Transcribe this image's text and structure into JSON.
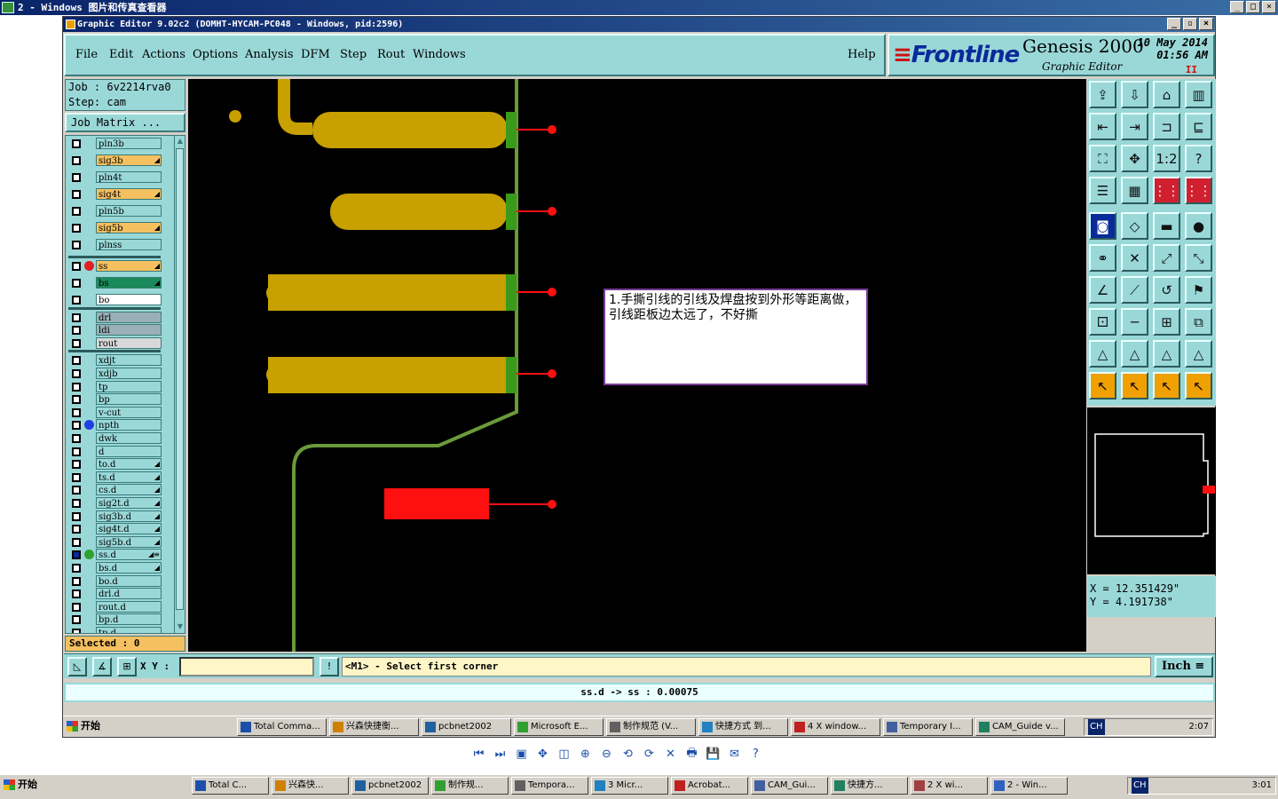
{
  "viewer": {
    "title": "2 - Windows 图片和传真查看器",
    "tools": [
      "⏮",
      "⏭",
      "▣",
      "✥",
      "◫",
      "⊕",
      "⊖",
      "⟲",
      "⟳",
      "✕",
      "🖶",
      "💾",
      "✉",
      "?"
    ]
  },
  "app": {
    "title": "Graphic Editor 9.02c2  (DOMHT-HYCAM-PC048 - Windows, pid:2596)",
    "menu": [
      "File",
      "Edit",
      "Actions",
      "Options",
      "Analysis",
      "DFM",
      "Step",
      "Rout",
      "Windows"
    ],
    "help": "Help",
    "logo": {
      "brand": "Frontline",
      "product": "Genesis 2000",
      "sub": "Graphic Editor",
      "date_line1": "10 May 2014",
      "date_line2": "01:56 AM",
      "pause": "II"
    }
  },
  "job": {
    "line1": "Job :  6v2214rva0",
    "line2": "Step: cam",
    "matrix_btn": "Job Matrix ..."
  },
  "layers": [
    {
      "name": "pln3b",
      "color": "#9ad8d8",
      "flag": ""
    },
    {
      "name": "sig3b",
      "color": "#f5c060",
      "flag": "◢"
    },
    {
      "name": "pln4t",
      "color": "#9ad8d8",
      "flag": ""
    },
    {
      "name": "sig4t",
      "color": "#f5c060",
      "flag": "◢"
    },
    {
      "name": "pln5b",
      "color": "#9ad8d8",
      "flag": ""
    },
    {
      "name": "sig5b",
      "color": "#f5c060",
      "flag": "◢"
    },
    {
      "name": "plnss",
      "color": "#9ad8d8",
      "flag": ""
    },
    {
      "name": "ss",
      "color": "#f5c060",
      "flag": "◢",
      "dot": "#e02020"
    },
    {
      "name": "bs",
      "color": "#1a8a5a",
      "flag": "◢"
    },
    {
      "name": "bo",
      "color": "#ffffff",
      "flag": ""
    },
    {
      "name": "drl",
      "color": "#9ab0b8",
      "flag": ""
    },
    {
      "name": "ldi",
      "color": "#9ab0b8",
      "flag": ""
    },
    {
      "name": "rout",
      "color": "#d8d8d8",
      "flag": ""
    },
    {
      "name": "xdjt",
      "color": "#9ad8d8",
      "flag": ""
    },
    {
      "name": "xdjb",
      "color": "#9ad8d8",
      "flag": ""
    },
    {
      "name": "tp",
      "color": "#9ad8d8",
      "flag": ""
    },
    {
      "name": "bp",
      "color": "#9ad8d8",
      "flag": ""
    },
    {
      "name": "v-cut",
      "color": "#9ad8d8",
      "flag": ""
    },
    {
      "name": "npth",
      "color": "#9ad8d8",
      "flag": "",
      "dot": "#2040e0"
    },
    {
      "name": "dwk",
      "color": "#9ad8d8",
      "flag": ""
    },
    {
      "name": "d",
      "color": "#9ad8d8",
      "flag": ""
    },
    {
      "name": "to.d",
      "color": "#9ad8d8",
      "flag": "◢"
    },
    {
      "name": "ts.d",
      "color": "#9ad8d8",
      "flag": "◢"
    },
    {
      "name": "cs.d",
      "color": "#9ad8d8",
      "flag": "◢"
    },
    {
      "name": "sig2t.d",
      "color": "#9ad8d8",
      "flag": "◢"
    },
    {
      "name": "sig3b.d",
      "color": "#9ad8d8",
      "flag": "◢"
    },
    {
      "name": "sig4t.d",
      "color": "#9ad8d8",
      "flag": "◢"
    },
    {
      "name": "sig5b.d",
      "color": "#9ad8d8",
      "flag": "◢"
    },
    {
      "name": "ss.d",
      "color": "#9ad8d8",
      "flag": "◢≡",
      "dot": "#30a030",
      "checked": true
    },
    {
      "name": "bs.d",
      "color": "#9ad8d8",
      "flag": "◢"
    },
    {
      "name": "bo.d",
      "color": "#9ad8d8",
      "flag": ""
    },
    {
      "name": "drl.d",
      "color": "#9ad8d8",
      "flag": ""
    },
    {
      "name": "rout.d",
      "color": "#9ad8d8",
      "flag": ""
    },
    {
      "name": "bp.d",
      "color": "#9ad8d8",
      "flag": ""
    },
    {
      "name": "tp.d",
      "color": "#9ad8d8",
      "flag": ""
    }
  ],
  "selected": "Selected : 0",
  "note": "1.手撕引线的引线及焊盘按到外形等距离做，引线距板边太远了，不好撕",
  "toolbox": [
    "⇪",
    "⇩",
    "⌂",
    "▥",
    "⇤",
    "⇥",
    "⊐",
    "⊑",
    "⛶",
    "✥",
    "1:2",
    "?",
    "☰",
    "▦",
    "⋮⋮",
    "⋮⋮",
    "◙",
    "◇",
    "▬",
    "●",
    "⚭",
    "✕",
    "⤢",
    "⤡",
    "∠",
    "⟋",
    "↺",
    "⚑",
    "⚀",
    "─",
    "⊞",
    "⧉",
    "△",
    "△",
    "△",
    "△",
    "↖",
    "↖",
    "↖",
    "↖"
  ],
  "coords": {
    "x": "X  =  12.351429\"",
    "y": "Y  =  4.191738\""
  },
  "cmd": {
    "xy_label": "X Y :",
    "xy_value": "",
    "prompt": "<M1> - Select first corner",
    "units": "Inch ≡"
  },
  "status": "ss.d -> ss : 0.00075",
  "taskbar_inner": {
    "start": "开始",
    "items": [
      "Total Comma...",
      "兴森快捷衡...",
      "pcbnet2002",
      "Microsoft E...",
      "制作规范 (V...",
      "快捷方式 到...",
      "4 X window...",
      "Temporary I...",
      "CAM_Guide v..."
    ],
    "lang": "CH",
    "clock": "2:07"
  },
  "taskbar_outer": {
    "start": "开始",
    "items": [
      "Total C...",
      "兴森快...",
      "pcbnet2002",
      "制作规...",
      "Tempora...",
      "3 Micr...",
      "Acrobat...",
      "CAM_Gui...",
      "快捷方...",
      "2 X wi...",
      "2 - Win..."
    ],
    "lang": "CH",
    "clock": "3:01"
  }
}
